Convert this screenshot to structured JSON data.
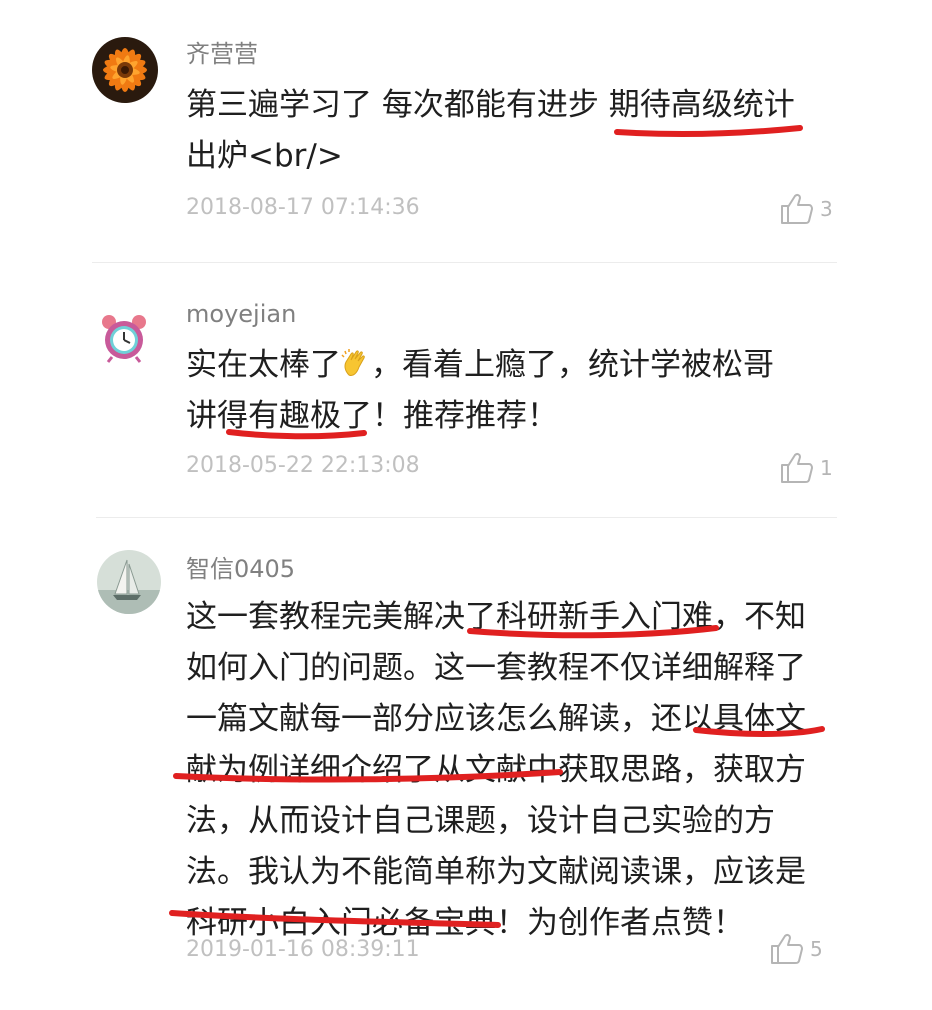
{
  "comments": [
    {
      "username": "齐营营",
      "avatar_icon": "orange-flower-avatar",
      "lines": [
        "第三遍学习了 每次都能有进步 期待高级统计",
        "出炉<br/>"
      ],
      "time": "2018-08-17 07:14:36",
      "likes": "3"
    },
    {
      "username": "moyejian",
      "avatar_icon": "alarm-clock-avatar",
      "line1_before": "实在太棒了",
      "emoji": "clapping-hands",
      "line1_after": "，看着上瘾了，统计学被松哥",
      "line2": "讲得有趣极了！推荐推荐！",
      "time": "2018-05-22 22:13:08",
      "likes": "1"
    },
    {
      "username": "智信0405",
      "avatar_icon": "sailboat-avatar",
      "lines": [
        "这一套教程完美解决了科研新手入门难，不知",
        "如何入门的问题。这一套教程不仅详细解释了",
        "一篇文献每一部分应该怎么解读，还以具体文",
        "献为例详细介绍了从文献中获取思路，获取方",
        "法，从而设计自己课题，设计自己实验的方",
        "法。我认为不能简单称为文献阅读课，应该是",
        "科研小白入门必备宝典！为创作者点赞！"
      ],
      "time": "2019-01-16 08:39:11",
      "likes": "5"
    }
  ],
  "colors": {
    "underline": "#e02020",
    "username": "#808080",
    "timestamp": "#c0c0c0"
  },
  "icons": {
    "like": "thumbs-up-icon"
  }
}
